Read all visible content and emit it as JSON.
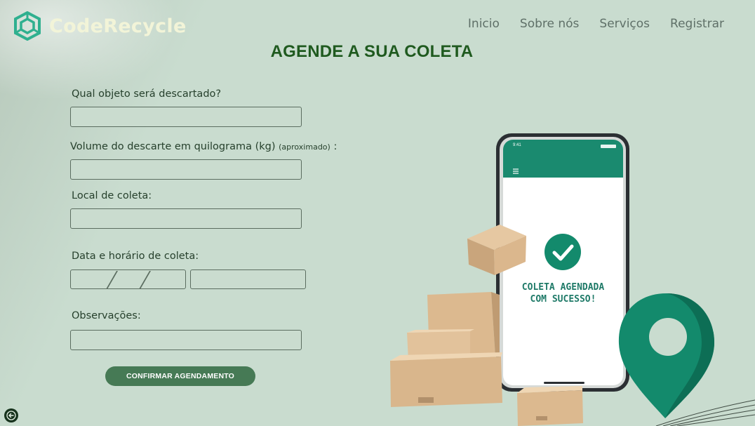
{
  "header": {
    "brand": "CodeRecycle",
    "nav": [
      "Inicio",
      "Sobre nós",
      "Serviços",
      "Registrar"
    ]
  },
  "page": {
    "title": "AGENDE A SUA COLETA"
  },
  "form": {
    "object_label": "Qual objeto será descartado?",
    "volume_label": "Volume do descarte em quilograma (kg)",
    "volume_hint": "(aproximado)",
    "volume_suffix": ":",
    "location_label": "Local de coleta:",
    "datetime_label": "Data e horário de coleta:",
    "notes_label": "Observações:",
    "confirm_label": "CONFIRMAR AGENDAMENTO"
  },
  "illustration": {
    "phone_time": "9:41",
    "phone_message": "COLETA AGENDADA COM SUCESSO!"
  },
  "colors": {
    "background": "#c9dccf",
    "title_green": "#1f5a1f",
    "button_green": "#467a55",
    "teal": "#138a6c"
  },
  "icons": [
    "recycle-logo-icon",
    "back-arrow-icon",
    "check-icon",
    "location-pin-icon",
    "menu-icon"
  ]
}
